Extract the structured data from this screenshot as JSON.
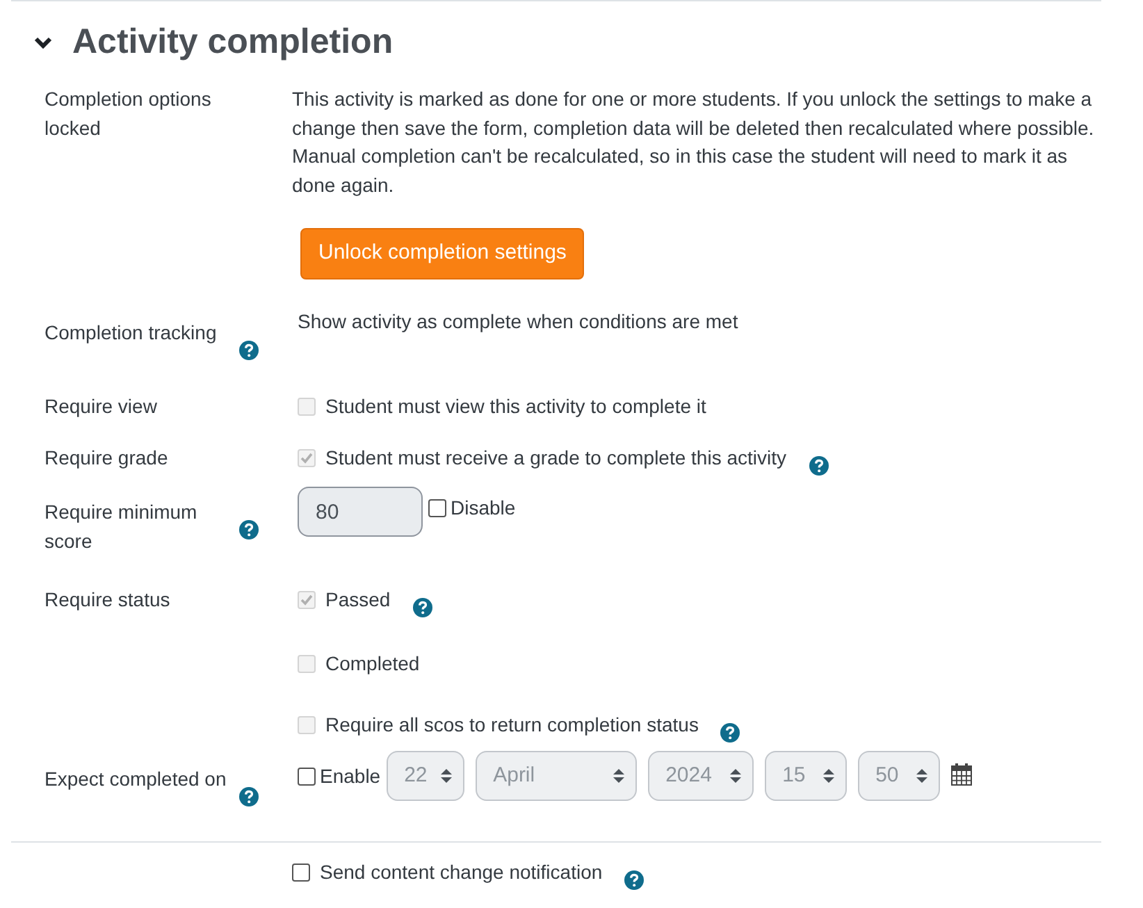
{
  "header": {
    "title": "Activity completion",
    "expanded": true
  },
  "locked": {
    "label": "Completion options locked",
    "message": "This activity is marked as done for one or more students. If you unlock the settings to make a change then save the form, completion data will be deleted then recalculated where possible. Manual completion can't be recalculated, so in this case the student will need to mark it as done again.",
    "button": "Unlock completion settings"
  },
  "rows": [
    {
      "kind": "text",
      "label": "Completion tracking",
      "help": true,
      "text": "Show activity as complete when conditions are met"
    },
    {
      "kind": "checkbox",
      "label": "Require view",
      "options": [
        {
          "label": "Student must view this activity to complete it",
          "checked": false,
          "disabled": true
        }
      ]
    },
    {
      "kind": "checkbox",
      "label": "Require grade",
      "options": [
        {
          "label": "Student must receive a grade to complete this activity",
          "checked": true,
          "disabled": true,
          "help": true
        }
      ]
    },
    {
      "kind": "score",
      "label": "Require minimum score",
      "help": true,
      "value": "80",
      "disable": {
        "label": "Disable",
        "checked": false
      }
    },
    {
      "kind": "checkbox",
      "label": "Require status",
      "options": [
        {
          "label": "Passed",
          "checked": true,
          "disabled": true,
          "help": true
        },
        {
          "label": "Completed",
          "checked": false,
          "disabled": true
        },
        {
          "label": "Require all scos to return completion status",
          "checked": false,
          "disabled": true,
          "help": true
        }
      ]
    },
    {
      "kind": "date",
      "label": "Expect completed on",
      "help": true,
      "enable": {
        "label": "Enable",
        "checked": false
      },
      "fields": [
        {
          "value": "22",
          "disabled": true
        },
        {
          "value": "April",
          "disabled": true
        },
        {
          "value": "2024",
          "disabled": true
        },
        {
          "value": "15",
          "disabled": true
        },
        {
          "value": "50",
          "disabled": true
        }
      ]
    }
  ],
  "notification": {
    "label": "Send content change notification",
    "checked": false,
    "disabled": false,
    "help": true
  }
}
